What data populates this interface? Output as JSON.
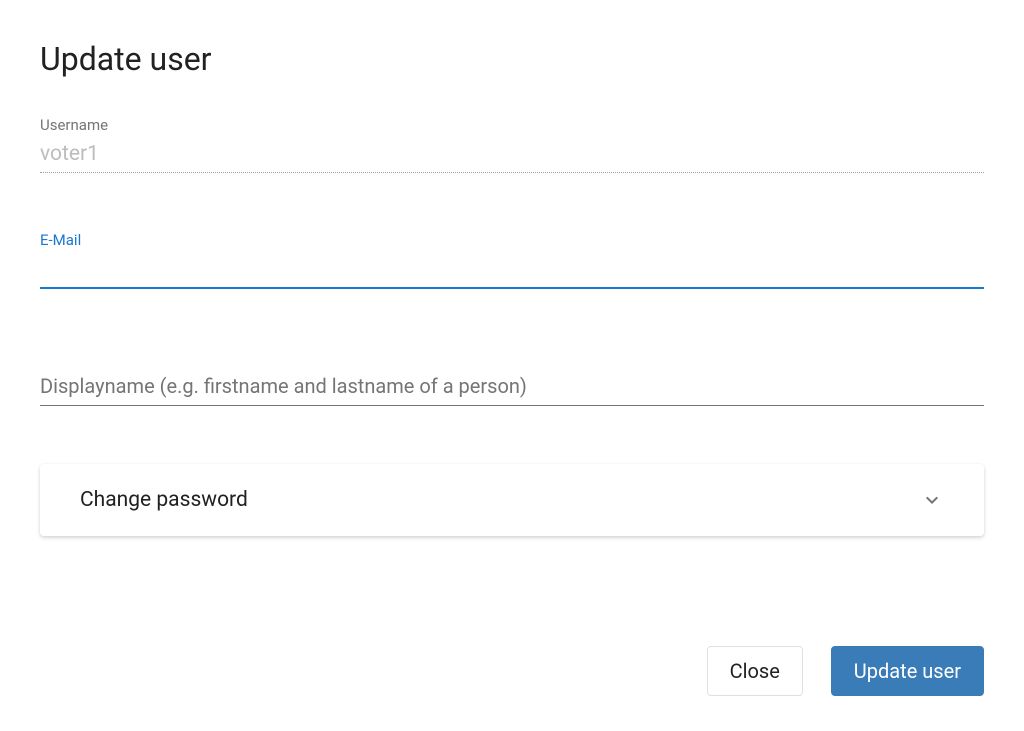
{
  "dialog": {
    "title": "Update user"
  },
  "fields": {
    "username": {
      "label": "Username",
      "value": "voter1"
    },
    "email": {
      "label": "E-Mail",
      "value": ""
    },
    "displayname": {
      "placeholder": "Displayname (e.g. firstname and lastname of a person)",
      "value": ""
    }
  },
  "expansion": {
    "change_password": "Change password"
  },
  "buttons": {
    "close": "Close",
    "update": "Update user"
  }
}
